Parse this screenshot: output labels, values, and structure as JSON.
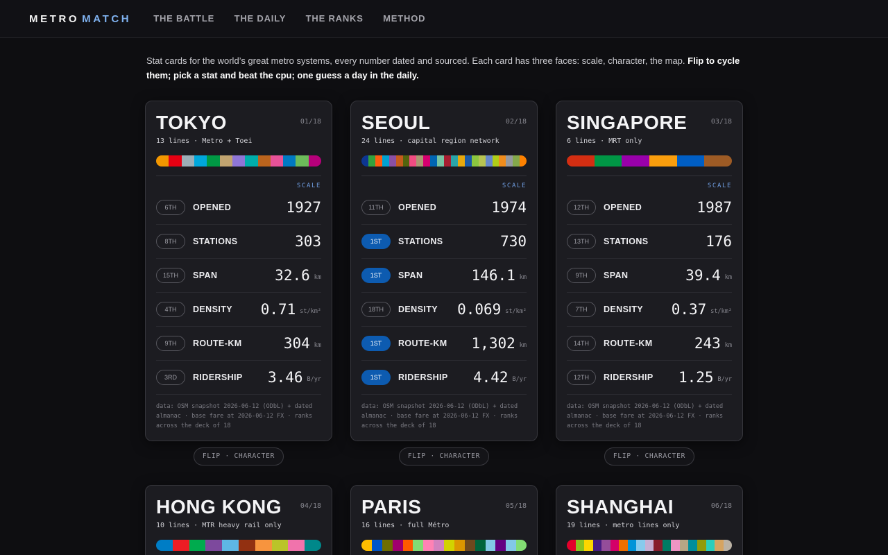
{
  "brand": {
    "part1": "METRO",
    "part2": "MATCH"
  },
  "nav": [
    "THE BATTLE",
    "THE DAILY",
    "THE RANKS",
    "METHOD"
  ],
  "intro": {
    "text": "Stat cards for the world’s great metro systems, every number dated and sourced. Each card has three faces: scale, character, the map. ",
    "bold": "Flip to cycle them; pick a stat and beat the cpu; one guess a day in the daily."
  },
  "section_label": "SCALE",
  "flip_label": "FLIP · CHARACTER",
  "footnote": "data: OSM snapshot 2026-06-12 (ODbL) + dated almanac · base fare at 2026-06-12 FX · ranks across the deck of 18",
  "cards": [
    {
      "city": "TOKYO",
      "number": "01/18",
      "subtitle": "13 lines · Metro + Toei",
      "line_colors": [
        "#f39700",
        "#e60012",
        "#9caeb7",
        "#00a7db",
        "#009944",
        "#c1a470",
        "#8f76d6",
        "#00ada9",
        "#bb641d",
        "#e85298",
        "#0079c2",
        "#6cbb5a",
        "#b6007a"
      ],
      "stats": [
        {
          "rank": "6TH",
          "first": false,
          "label": "OPENED",
          "value": "1927",
          "unit": ""
        },
        {
          "rank": "8TH",
          "first": false,
          "label": "STATIONS",
          "value": "303",
          "unit": ""
        },
        {
          "rank": "15TH",
          "first": false,
          "label": "SPAN",
          "value": "32.6",
          "unit": "km"
        },
        {
          "rank": "4TH",
          "first": false,
          "label": "DENSITY",
          "value": "0.71",
          "unit": "st/km²"
        },
        {
          "rank": "9TH",
          "first": false,
          "label": "ROUTE-KM",
          "value": "304",
          "unit": "km"
        },
        {
          "rank": "3RD",
          "first": false,
          "label": "RIDERSHIP",
          "value": "3.46",
          "unit": "B/yr"
        }
      ]
    },
    {
      "city": "SEOUL",
      "number": "02/18",
      "subtitle": "24 lines · capital region network",
      "line_colors": [
        "#0d3692",
        "#33a23d",
        "#fe5d10",
        "#00a2d1",
        "#8b50a4",
        "#c55c1d",
        "#54640d",
        "#f14c82",
        "#aa9872",
        "#d6006f",
        "#0065b3",
        "#77c4a3",
        "#a71e31",
        "#2aa5a9",
        "#e6a80d",
        "#1a5aa6",
        "#8cc63f",
        "#b7c452",
        "#6789ca",
        "#b0ce18",
        "#f08d1d",
        "#969aa0",
        "#84a94b",
        "#fd8100"
      ],
      "stats": [
        {
          "rank": "11TH",
          "first": false,
          "label": "OPENED",
          "value": "1974",
          "unit": ""
        },
        {
          "rank": "1ST",
          "first": true,
          "label": "STATIONS",
          "value": "730",
          "unit": ""
        },
        {
          "rank": "1ST",
          "first": true,
          "label": "SPAN",
          "value": "146.1",
          "unit": "km"
        },
        {
          "rank": "18TH",
          "first": false,
          "label": "DENSITY",
          "value": "0.069",
          "unit": "st/km²"
        },
        {
          "rank": "1ST",
          "first": true,
          "label": "ROUTE-KM",
          "value": "1,302",
          "unit": "km"
        },
        {
          "rank": "1ST",
          "first": true,
          "label": "RIDERSHIP",
          "value": "4.42",
          "unit": "B/yr"
        }
      ]
    },
    {
      "city": "SINGAPORE",
      "number": "03/18",
      "subtitle": "6 lines · MRT only",
      "line_colors": [
        "#d42e12",
        "#009645",
        "#9900aa",
        "#fa9e0d",
        "#005ec4",
        "#9d5b25"
      ],
      "stats": [
        {
          "rank": "12TH",
          "first": false,
          "label": "OPENED",
          "value": "1987",
          "unit": ""
        },
        {
          "rank": "13TH",
          "first": false,
          "label": "STATIONS",
          "value": "176",
          "unit": ""
        },
        {
          "rank": "9TH",
          "first": false,
          "label": "SPAN",
          "value": "39.4",
          "unit": "km"
        },
        {
          "rank": "7TH",
          "first": false,
          "label": "DENSITY",
          "value": "0.37",
          "unit": "st/km²"
        },
        {
          "rank": "14TH",
          "first": false,
          "label": "ROUTE-KM",
          "value": "243",
          "unit": "km"
        },
        {
          "rank": "12TH",
          "first": false,
          "label": "RIDERSHIP",
          "value": "1.25",
          "unit": "B/yr"
        }
      ]
    },
    {
      "city": "HONG KONG",
      "number": "04/18",
      "subtitle": "10 lines · MTR heavy rail only",
      "line_colors": [
        "#007dc5",
        "#ed1d24",
        "#00ab4e",
        "#7d499d",
        "#5eb6e4",
        "#923011",
        "#f7943e",
        "#bac429",
        "#f173ac",
        "#00888a"
      ],
      "stats": []
    },
    {
      "city": "PARIS",
      "number": "05/18",
      "subtitle": "16 lines · full Métro",
      "line_colors": [
        "#ffbe00",
        "#0055c8",
        "#6e6e00",
        "#a0006e",
        "#ff5a00",
        "#82dc73",
        "#ff82b4",
        "#d282be",
        "#d2d200",
        "#dc9600",
        "#6e491e",
        "#00643c",
        "#82c8e6",
        "#640082",
        "#82c8e6",
        "#82dc73"
      ],
      "stats": []
    },
    {
      "city": "SHANGHAI",
      "number": "06/18",
      "subtitle": "19 lines · metro lines only",
      "line_colors": [
        "#e3002b",
        "#8cc220",
        "#fcd600",
        "#461d84",
        "#944d9a",
        "#d40068",
        "#ed6f00",
        "#0094d8",
        "#87caed",
        "#c6afd4",
        "#871c2b",
        "#007b63",
        "#ef95c4",
        "#b5a685",
        "#008e9c",
        "#929b0b",
        "#2bcebc",
        "#d6a461",
        "#bbb2a5"
      ],
      "stats": []
    }
  ]
}
